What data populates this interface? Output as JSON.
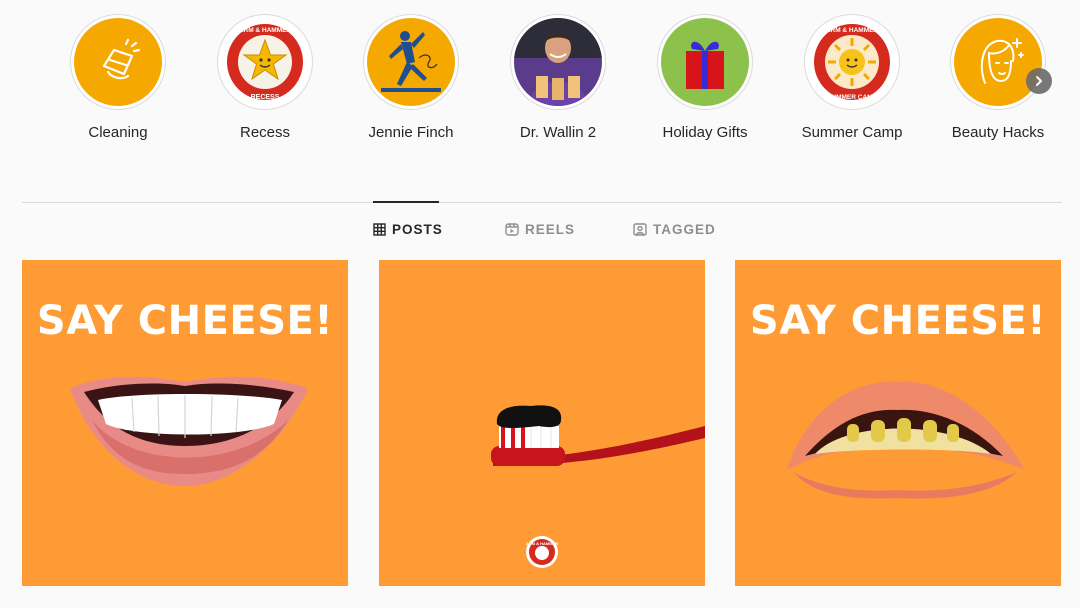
{
  "highlights": [
    {
      "label": "Cleaning",
      "icon": "cleaning-hand-icon",
      "bg": "#f5a800"
    },
    {
      "label": "Recess",
      "icon": "recess-badge-icon",
      "bg": "#ffffff"
    },
    {
      "label": "Jennie Finch",
      "icon": "softball-pitcher-icon",
      "bg": "#f5a800"
    },
    {
      "label": "Dr. Wallin 2",
      "icon": "doctor-photo-icon",
      "bg": "#5a3b8c"
    },
    {
      "label": "Holiday Gifts",
      "icon": "gift-box-icon",
      "bg": "#8cc14c"
    },
    {
      "label": "Summer Camp",
      "icon": "summer-camp-badge-icon",
      "bg": "#ffffff"
    },
    {
      "label": "Beauty Hacks",
      "icon": "beauty-face-icon",
      "bg": "#f5a800"
    }
  ],
  "badges": {
    "recess_top": "ARM & HAMMER",
    "recess_bottom": "RECESS",
    "summer_top": "ARM & HAMMER",
    "summer_bottom": "SUMMER CAMP",
    "logo_text": "ARM & HAMMER"
  },
  "tabs": [
    {
      "label": "POSTS",
      "icon": "grid-icon",
      "active": true
    },
    {
      "label": "REELS",
      "icon": "reels-icon",
      "active": false
    },
    {
      "label": "TAGGED",
      "icon": "tagged-icon",
      "active": false
    }
  ],
  "posts": [
    {
      "title": "SAY CHEESE!",
      "image": "white-teeth-smile"
    },
    {
      "title": "",
      "image": "toothbrush-charcoal-paste"
    },
    {
      "title": "SAY CHEESE!",
      "image": "yellow-teeth-smile"
    }
  ],
  "colors": {
    "post_bg": "#ff9b34",
    "highlight_orange": "#f5a800",
    "arm_hammer_red": "#d52b1e",
    "text": "#262626",
    "muted": "#8e8e8e"
  }
}
